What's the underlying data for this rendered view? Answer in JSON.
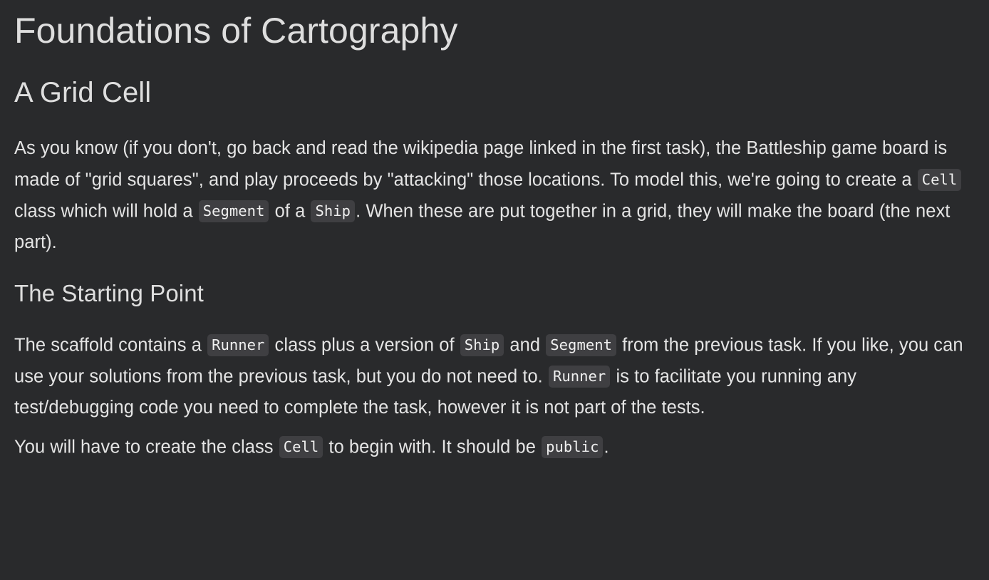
{
  "document": {
    "title": "Foundations of Cartography",
    "section_heading": "A Grid Cell",
    "paragraphs": [
      {
        "id": "intro",
        "parts": [
          {
            "type": "text",
            "value": "As you know (if you don't, go back and read the wikipedia page linked in the first task), the Battleship game board is made of \"grid squares\", and play proceeds by \"attacking\" those locations. To model this, we're going to create a "
          },
          {
            "type": "code",
            "value": "Cell"
          },
          {
            "type": "text",
            "value": " class which will hold a "
          },
          {
            "type": "code",
            "value": "Segment"
          },
          {
            "type": "text",
            "value": " of a "
          },
          {
            "type": "code",
            "value": "Ship"
          },
          {
            "type": "text",
            "value": ". When these are put together in a grid, they will make the board (the next part)."
          }
        ]
      }
    ],
    "subsection_heading": "The Starting Point",
    "subsection_paragraphs": [
      {
        "id": "scaffold",
        "parts": [
          {
            "type": "text",
            "value": "The scaffold contains a "
          },
          {
            "type": "code",
            "value": "Runner"
          },
          {
            "type": "text",
            "value": " class plus a version of "
          },
          {
            "type": "code",
            "value": "Ship"
          },
          {
            "type": "text",
            "value": " and "
          },
          {
            "type": "code",
            "value": "Segment"
          },
          {
            "type": "text",
            "value": " from the previous task. If you like, you can use your solutions from the previous task, but you do not need to. "
          },
          {
            "type": "code",
            "value": "Runner"
          },
          {
            "type": "text",
            "value": " is to facilitate you running any test/debugging code you need to complete the task, however it is not part of the tests."
          }
        ]
      },
      {
        "id": "create-class",
        "parts": [
          {
            "type": "text",
            "value": "You will have to create the class "
          },
          {
            "type": "code",
            "value": "Cell"
          },
          {
            "type": "text",
            "value": " to begin with. It should be "
          },
          {
            "type": "code",
            "value": "public"
          },
          {
            "type": "text",
            "value": "."
          }
        ]
      }
    ]
  },
  "theme": {
    "background": "#292a2c",
    "heading_color": "#dedede",
    "body_color": "#e4e4e4",
    "code_background": "#3f3f42",
    "code_color": "#f0f0f0"
  }
}
